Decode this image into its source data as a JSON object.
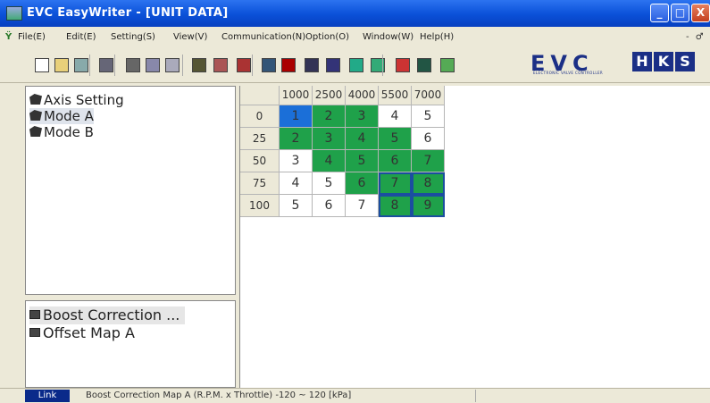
{
  "window": {
    "title": "EVC EasyWriter - [UNIT DATA]",
    "controls": {
      "minimize": "_",
      "maximize": "□",
      "close": "X"
    }
  },
  "menu": {
    "items": [
      "File(E)",
      "Edit(E)",
      "Setting(S)",
      "View(V)",
      "Communication(N)",
      "Option(O)",
      "Window(W)",
      "Help(H)"
    ],
    "mdi_controls": "- ♂ x"
  },
  "toolbar": {
    "buttons": [
      "new-icon",
      "open-icon",
      "save-icon",
      "print-icon",
      "cut-icon",
      "copy-icon",
      "paste-icon",
      "sort-icon",
      "transpose-icon",
      "map-icon",
      "web-icon",
      "grid-icon",
      "chart-icon",
      "write-icon",
      "compare-icon",
      "monitor-icon",
      "graph-icon",
      "display-icon",
      "unit-icon"
    ],
    "logo_text": "EVC",
    "logo_subtext": "ELECTRONIC VALVE CONTROLLER",
    "brand_text": "HKS"
  },
  "tree": {
    "items": [
      {
        "label": "Axis Setting"
      },
      {
        "label": "Mode A"
      },
      {
        "label": "Mode B"
      }
    ]
  },
  "maplist": {
    "items": [
      {
        "label": "Boost Correction ..."
      },
      {
        "label": "Offset Map A"
      }
    ]
  },
  "grid": {
    "columns": [
      "1000",
      "2500",
      "4000",
      "5500",
      "7000"
    ],
    "rows": [
      {
        "header": "0",
        "cells": [
          "1",
          "2",
          "3",
          "4",
          "5"
        ],
        "fill": [
          "blue",
          "green",
          "green",
          "white",
          "white"
        ]
      },
      {
        "header": "25",
        "cells": [
          "2",
          "3",
          "4",
          "5",
          "6"
        ],
        "fill": [
          "green",
          "green",
          "green",
          "green",
          "white"
        ]
      },
      {
        "header": "50",
        "cells": [
          "3",
          "4",
          "5",
          "6",
          "7"
        ],
        "fill": [
          "white",
          "green",
          "green",
          "green",
          "green"
        ]
      },
      {
        "header": "75",
        "cells": [
          "4",
          "5",
          "6",
          "7",
          "8"
        ],
        "fill": [
          "white",
          "white",
          "green",
          "green",
          "green"
        ]
      },
      {
        "header": "100",
        "cells": [
          "5",
          "6",
          "7",
          "8",
          "9"
        ],
        "fill": [
          "white",
          "white",
          "white",
          "green",
          "green"
        ]
      }
    ],
    "colors": {
      "green": "#1fa14a",
      "blue": "#1b6fd8",
      "header": "#ece9d8"
    }
  },
  "status": {
    "mode": "Link",
    "message": "Boost Correction Map A   (R.P.M. x Throttle)  -120  ~  120 [kPa]"
  }
}
